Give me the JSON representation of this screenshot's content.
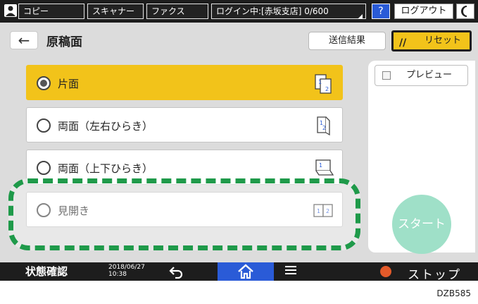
{
  "topbar": {
    "tabs": [
      "コピー",
      "スキャナー",
      "ファクス"
    ],
    "login_status": "ログイン中:[赤坂支店] 0/600",
    "help_label": "?",
    "logout_label": "ログアウト",
    "night_icon": "moon-icon"
  },
  "header": {
    "back_icon": "←",
    "title": "原稿面",
    "send_result_label": "送信結果",
    "reset_label": "リセット",
    "reset_icon": "//"
  },
  "options": [
    {
      "label": "片面",
      "selected": true,
      "icon": "single-sided-icon"
    },
    {
      "label": "両面（左右ひらき）",
      "selected": false,
      "icon": "duplex-left-right-icon"
    },
    {
      "label": "両面（上下ひらき）",
      "selected": false,
      "icon": "duplex-top-bottom-icon"
    },
    {
      "label": "見開き",
      "selected": false,
      "icon": "book-spread-icon"
    }
  ],
  "right_panel": {
    "preview_label": "プレビュー",
    "start_label": "スタート"
  },
  "bottombar": {
    "status_label": "状態確認",
    "date": "2018/06/27",
    "time": "10:38",
    "stop_label": "ストップ"
  },
  "image_code": "DZB585",
  "colors": {
    "selected": "#f2c31a",
    "accent_blue": "#2a5bd7",
    "start": "#9fe0c8",
    "highlight_dash": "#1f9a4a",
    "bar": "#1d1d1d"
  }
}
